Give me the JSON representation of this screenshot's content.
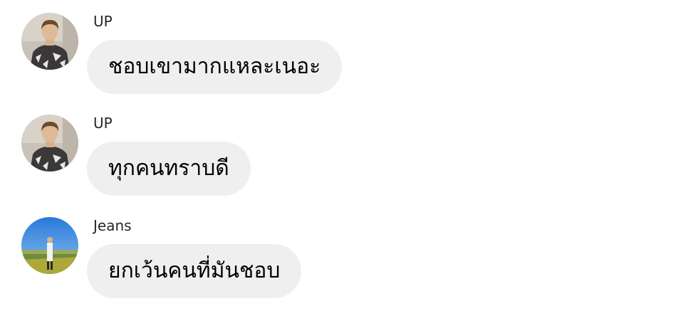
{
  "messages": [
    {
      "sender": "UP",
      "text": "ชอบเขามากแหละเนอะ",
      "avatar_icon": "profile-photo-up"
    },
    {
      "sender": "UP",
      "text": "ทุกคนทราบดี",
      "avatar_icon": "profile-photo-up"
    },
    {
      "sender": "Jeans",
      "text": "ยกเว้นคนที่มันชอบ",
      "avatar_icon": "profile-photo-jeans"
    }
  ],
  "colors": {
    "background": "#ffffff",
    "bubble": "#efefef",
    "sender_text": "#262626",
    "message_text": "#000000"
  }
}
